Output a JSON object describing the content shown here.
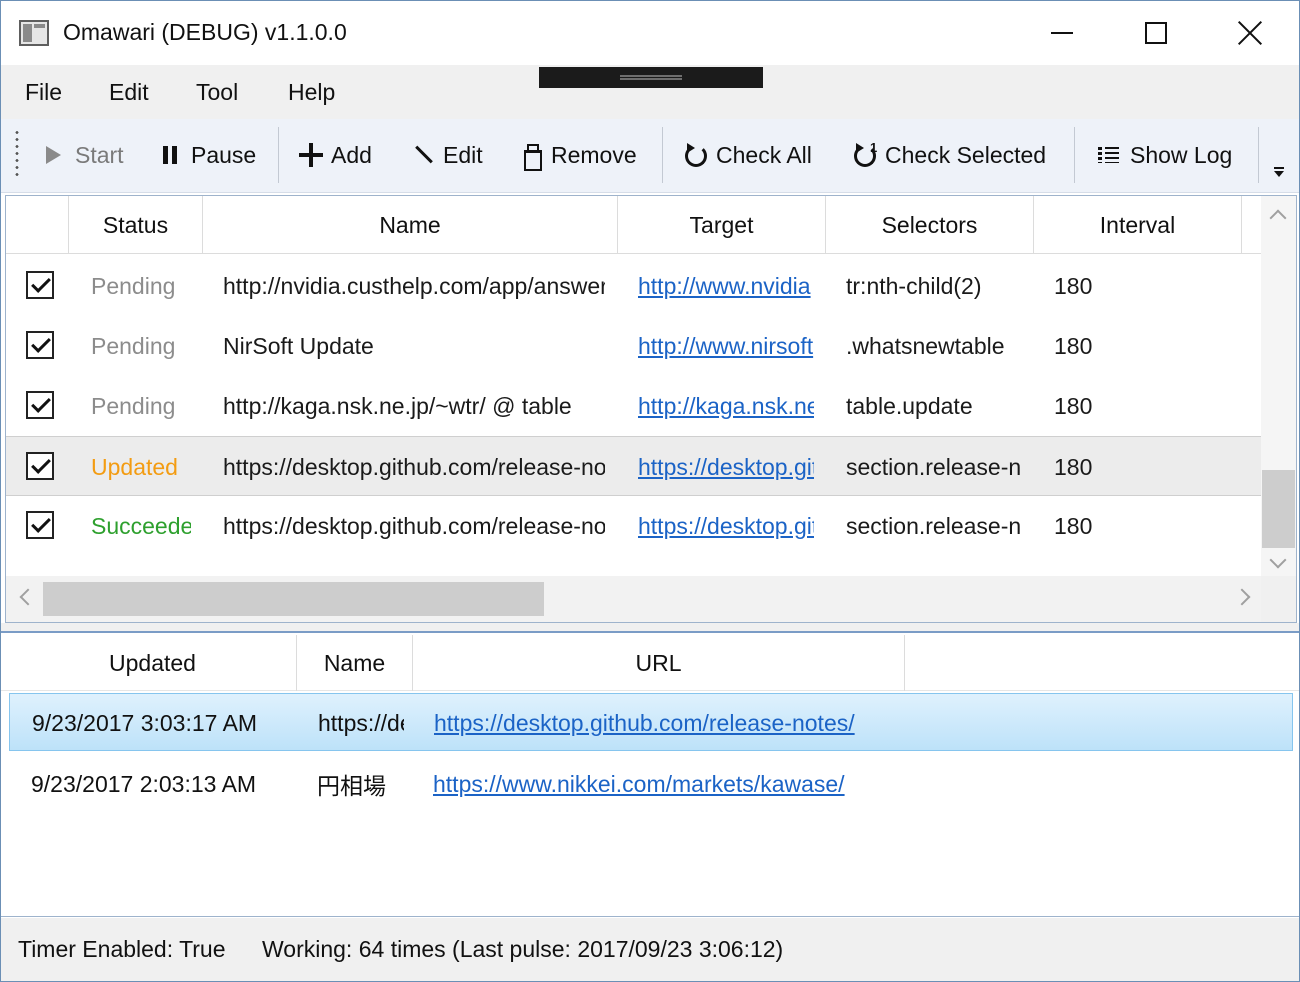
{
  "window": {
    "title": "Omawari (DEBUG) v1.1.0.0"
  },
  "menu": [
    "File",
    "Edit",
    "Tool",
    "Help"
  ],
  "toolbar": {
    "start": "Start",
    "pause": "Pause",
    "add": "Add",
    "edit": "Edit",
    "remove": "Remove",
    "check_all": "Check All",
    "check_selected": "Check Selected",
    "show_log": "Show Log"
  },
  "targets": {
    "columns": [
      "Status",
      "Name",
      "Target",
      "Selectors",
      "Interval"
    ],
    "rows": [
      {
        "checked": true,
        "status": "Pending",
        "status_kind": "pending",
        "name": "http://nvidia.custhelp.com/app/answers",
        "target": "http://www.nvidia",
        "selectors": "tr:nth-child(2)",
        "interval": "180"
      },
      {
        "checked": true,
        "status": "Pending",
        "status_kind": "pending",
        "name": "NirSoft Update",
        "target": "http://www.nirsoft",
        "selectors": ".whatsnewtable",
        "interval": "180"
      },
      {
        "checked": true,
        "status": "Pending",
        "status_kind": "pending",
        "name": "http://kaga.nsk.ne.jp/~wtr/ @ table",
        "target": "http://kaga.nsk.ne",
        "selectors": "table.update",
        "interval": "180"
      },
      {
        "checked": true,
        "status": "Updated",
        "status_kind": "updated",
        "name": "https://desktop.github.com/release-notes",
        "target": "https://desktop.github",
        "selectors": "section.release-notes",
        "interval": "180"
      },
      {
        "checked": true,
        "status": "Succeeded",
        "status_kind": "succeeded",
        "name": "https://desktop.github.com/release-notes",
        "target": "https://desktop.github",
        "selectors": "section.release-notes",
        "interval": "180"
      }
    ],
    "highlighted_row": 3
  },
  "log": {
    "columns": [
      "Updated",
      "Name",
      "URL"
    ],
    "rows": [
      {
        "updated": "9/23/2017 3:03:17 AM",
        "name": "https://desktop.github.com",
        "url": "https://desktop.github.com/release-notes/",
        "selected": true
      },
      {
        "updated": "9/23/2017 2:03:13 AM",
        "name": "円相場",
        "url": "https://www.nikkei.com/markets/kawase/",
        "selected": false
      }
    ]
  },
  "status": {
    "timer": "Timer Enabled: True",
    "working": "Working: 64 times (Last pulse: 2017/09/23 3:06:12)"
  },
  "colors": {
    "pending": "#8c8c8c",
    "updated": "#f39c12",
    "succeeded": "#2ea02e",
    "link": "#1b63c6",
    "selection": "#bde2f9"
  }
}
